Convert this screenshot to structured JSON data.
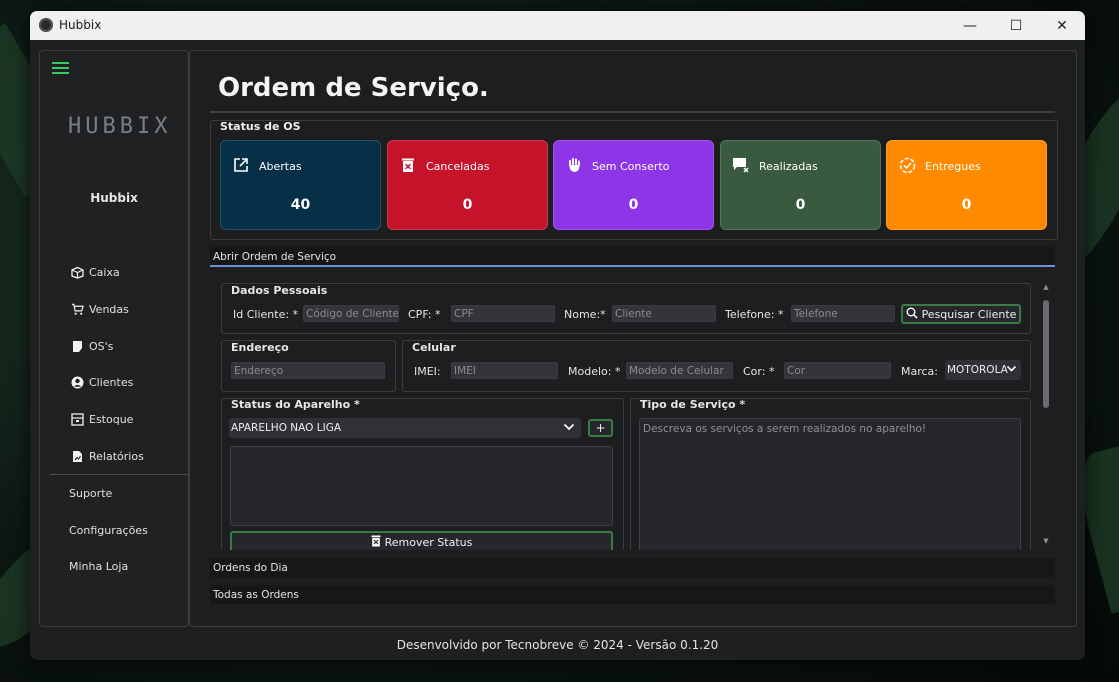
{
  "window": {
    "title": "Hubbix",
    "minimize": "—",
    "maximize": "☐",
    "close": "✕"
  },
  "sidebar": {
    "brand_logo": "HUBBIX",
    "brand_name": "Hubbix",
    "items": [
      {
        "label": "Caixa",
        "icon": "box-icon"
      },
      {
        "label": "Vendas",
        "icon": "cart-icon"
      },
      {
        "label": "OS's",
        "icon": "document-icon"
      },
      {
        "label": "Clientes",
        "icon": "user-icon"
      },
      {
        "label": "Estoque",
        "icon": "inventory-icon"
      },
      {
        "label": "Relatórios",
        "icon": "report-icon"
      }
    ],
    "secondary": [
      "Suporte",
      "Configurações",
      "Minha Loja"
    ]
  },
  "page": {
    "title": "Ordem de Serviço."
  },
  "status": {
    "group_label": "Status de OS",
    "cards": [
      {
        "label": "Abertas",
        "value": "40",
        "color": "#063048",
        "icon": "external-link-icon"
      },
      {
        "label": "Canceladas",
        "value": "0",
        "color": "#c5142a",
        "icon": "trash-x-icon"
      },
      {
        "label": "Sem Conserto",
        "value": "0",
        "color": "#8f35e8",
        "icon": "hand-stop-icon"
      },
      {
        "label": "Realizadas",
        "value": "0",
        "color": "#3a5a3f",
        "icon": "message-check-icon"
      },
      {
        "label": "Entregues",
        "value": "0",
        "color": "#ff8a00",
        "icon": "circle-check-icon"
      }
    ]
  },
  "sections": {
    "open_order": "Abrir Ordem de Serviço",
    "orders_today": "Ordens do Dia",
    "all_orders": "Todas as Ordens"
  },
  "form": {
    "personal": {
      "label": "Dados Pessoais",
      "id_label": "Id Cliente: *",
      "id_placeholder": "Código de Cliente",
      "cpf_label": "CPF: *",
      "cpf_placeholder": "CPF",
      "name_label": "Nome:*",
      "name_placeholder": "Cliente",
      "phone_label": "Telefone: *",
      "phone_placeholder": "Telefone",
      "search_button": "Pesquisar Cliente"
    },
    "address": {
      "label": "Endereço",
      "placeholder": "Endereço"
    },
    "phone_device": {
      "label": "Celular",
      "imei_label": "IMEI:",
      "imei_placeholder": "IMEI",
      "model_label": "Modelo: *",
      "model_placeholder": "Modelo de Celular",
      "color_label": "Cor: *",
      "color_placeholder": "Cor",
      "brand_label": "Marca:",
      "brand_value": "MOTOROLA"
    },
    "device_status": {
      "label": "Status do Aparelho *",
      "selected": "APARELHO NAO LIGA",
      "add_button": "+",
      "remove_button": "Remover Status"
    },
    "service_type": {
      "label": "Tipo de Serviço *",
      "placeholder": "Descreva os serviços a serem realizados no aparelho!"
    }
  },
  "footer": "Desenvolvido por Tecnobreve © 2024 - Versão 0.1.20",
  "colors": {
    "accent": "#33cc66",
    "active_tab": "#6d8fd6",
    "button_border": "#3a7d44"
  }
}
